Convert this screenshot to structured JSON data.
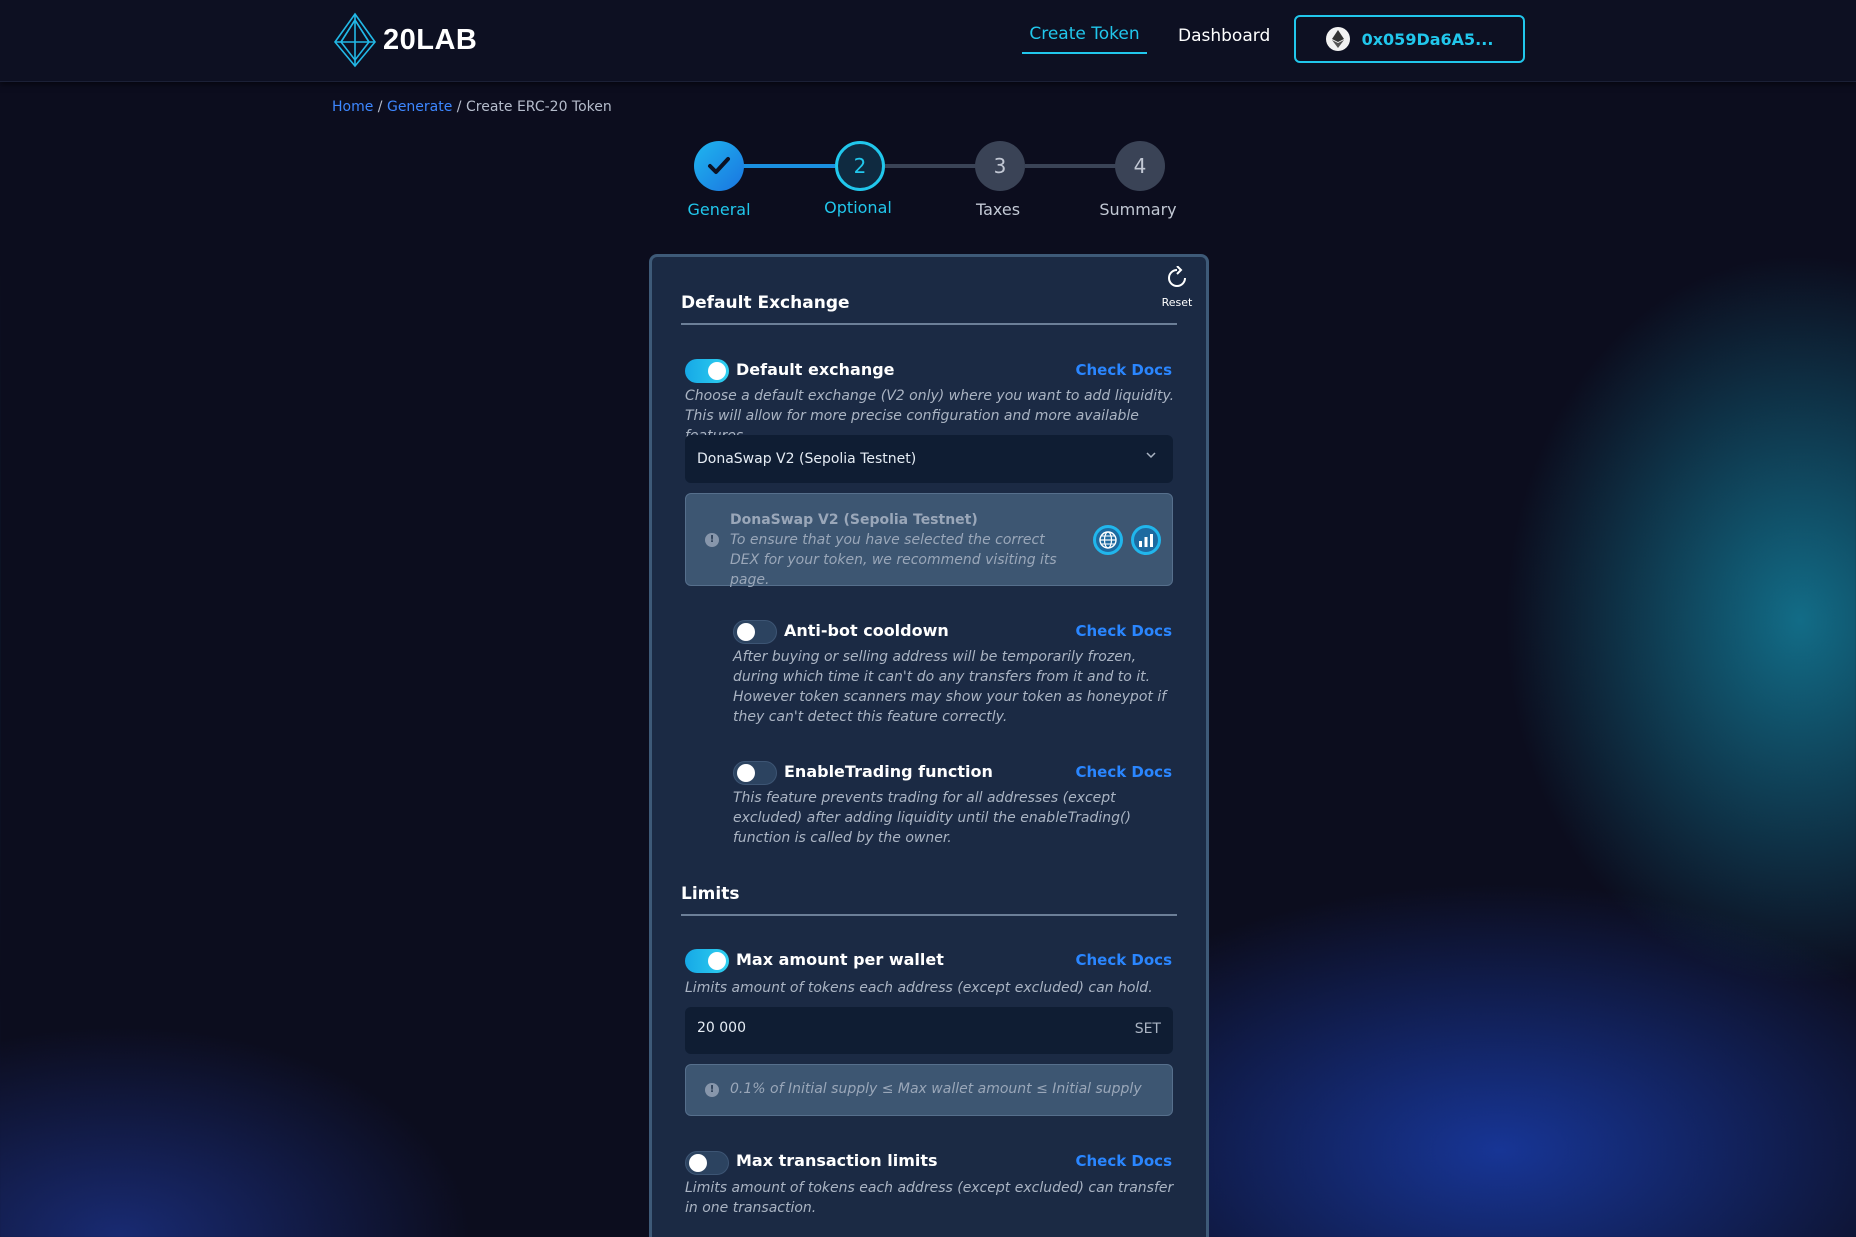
{
  "header": {
    "logo_text": "20LAB",
    "nav": {
      "create_token": "Create Token",
      "dashboard": "Dashboard"
    },
    "wallet_address": "0x059Da6A5..."
  },
  "breadcrumb": {
    "home": "Home",
    "separator": " / ",
    "generate": "Generate",
    "current": "Create ERC-20 Token"
  },
  "stepper": {
    "steps": [
      {
        "label": "General",
        "number": "",
        "state": "completed"
      },
      {
        "label": "Optional",
        "number": "2",
        "state": "active"
      },
      {
        "label": "Taxes",
        "number": "3",
        "state": "pending"
      },
      {
        "label": "Summary",
        "number": "4",
        "state": "pending"
      }
    ]
  },
  "card": {
    "reset_label": "Reset",
    "default_exchange": {
      "section_title": "Default Exchange",
      "toggle_title": "Default exchange",
      "toggle_on": true,
      "docs_label": "Check Docs",
      "description": "Choose a default exchange (V2 only) where you want to add liquidity. This will allow for more precise configuration and more available features.",
      "selected_exchange": "DonaSwap V2 (Sepolia Testnet)",
      "info_title": "DonaSwap V2 (Sepolia Testnet)",
      "info_text": "To ensure that you have selected the correct DEX for your token, we recommend visiting its page."
    },
    "anti_bot": {
      "title": "Anti-bot cooldown",
      "toggle_on": false,
      "docs_label": "Check Docs",
      "description": "After buying or selling address will be temporarily frozen, during which time it can't do any transfers from it and to it. However token scanners may show your token as honeypot if they can't detect this feature correctly."
    },
    "enable_trading": {
      "title": "EnableTrading function",
      "toggle_on": false,
      "docs_label": "Check Docs",
      "description": "This feature prevents trading for all addresses (except excluded) after adding liquidity until the enableTrading() function is called by the owner."
    },
    "limits": {
      "section_title": "Limits",
      "max_wallet": {
        "title": "Max amount per wallet",
        "toggle_on": true,
        "docs_label": "Check Docs",
        "description": "Limits amount of tokens each address (except excluded) can hold.",
        "value": "20 000",
        "set_label": "SET",
        "rule_text": "0.1% of Initial supply ≤ Max wallet amount ≤ Initial supply"
      },
      "max_tx": {
        "title": "Max transaction limits",
        "toggle_on": false,
        "docs_label": "Check Docs",
        "description": "Limits amount of tokens each address (except excluded) can transfer in one transaction."
      }
    }
  },
  "colors": {
    "accent": "#21c7ec",
    "link": "#2a86ff",
    "card_bg": "#1b2a44",
    "page_bg": "#0c0d1e"
  }
}
